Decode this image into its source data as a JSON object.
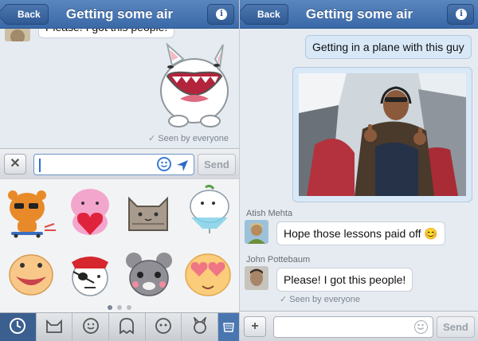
{
  "left_screen": {
    "nav": {
      "back_label": "Back",
      "title": "Getting some air",
      "info_icon": "info-icon"
    },
    "messages": [
      {
        "text": "Please! I got this people!",
        "from": "other"
      }
    ],
    "sticker_message": {
      "sticker": "happy-white-rabbit-sticker"
    },
    "seen_text": "Seen by everyone",
    "composer": {
      "clear_icon": "close-icon",
      "value": "",
      "emoji_icon": "smiley-icon",
      "location_icon": "location-arrow-icon",
      "send_label": "Send"
    },
    "stickers": [
      "tiger-skateboard-sticker",
      "pink-heart-blob-sticker",
      "gray-cat-sticker",
      "white-bird-cocktail-sticker",
      "yellow-face-sticker",
      "pirate-bunny-sticker",
      "gray-mouse-sticker",
      "heart-eyes-face-sticker"
    ],
    "page_dots": {
      "count": 3,
      "active": 0
    },
    "tabs": [
      "clock-icon",
      "cat-outline-icon",
      "smiley-outline-icon",
      "ghost-outline-icon",
      "face-outline-icon",
      "bunny-outline-icon",
      "store-icon"
    ]
  },
  "right_screen": {
    "nav": {
      "back_label": "Back",
      "title": "Getting some air",
      "info_icon": "info-icon"
    },
    "my_message": "Getting in a plane with this guy",
    "photo": {
      "subject": "man-in-plane-cockpit-thumbs-up-photo"
    },
    "messages": [
      {
        "sender": "Atish Mehta",
        "text": "Hope those lessons paid off",
        "emoji": "😊"
      },
      {
        "sender": "John Pottebaum",
        "text": "Please! I got this people!"
      }
    ],
    "seen_text": "Seen by everyone",
    "composer": {
      "add_icon": "plus-icon",
      "value": "",
      "emoji_icon": "smiley-icon",
      "send_label": "Send"
    }
  }
}
